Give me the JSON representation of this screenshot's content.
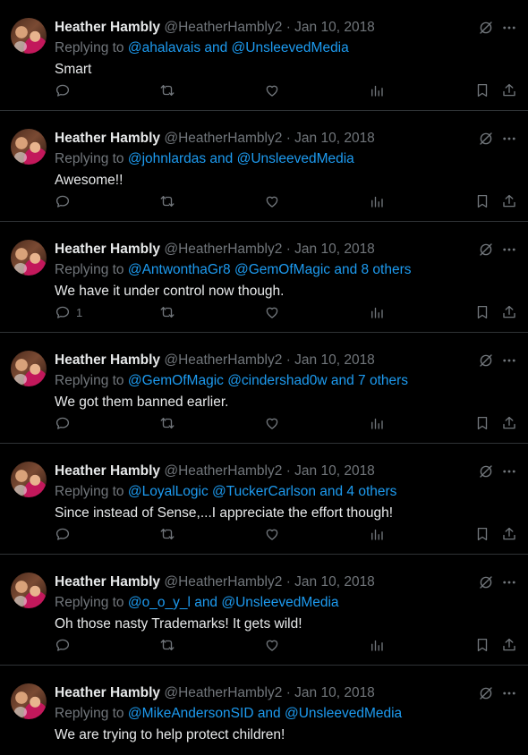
{
  "tweets": [
    {
      "name": "Heather Hambly",
      "handle": "@HeatherHambly2",
      "sep": "·",
      "date": "Jan 10, 2018",
      "reply_prefix": "Replying to ",
      "reply_to": "@ahalavais and @UnsleevedMedia",
      "text": "Smart",
      "reply_count": ""
    },
    {
      "name": "Heather Hambly",
      "handle": "@HeatherHambly2",
      "sep": "·",
      "date": "Jan 10, 2018",
      "reply_prefix": "Replying to ",
      "reply_to": "@johnlardas and @UnsleevedMedia",
      "text": "Awesome!!",
      "reply_count": ""
    },
    {
      "name": "Heather Hambly",
      "handle": "@HeatherHambly2",
      "sep": "·",
      "date": "Jan 10, 2018",
      "reply_prefix": "Replying to ",
      "reply_to": "@AntwonthaGr8 @GemOfMagic and 8 others",
      "text": "We have it under control now though.",
      "reply_count": "1"
    },
    {
      "name": "Heather Hambly",
      "handle": "@HeatherHambly2",
      "sep": "·",
      "date": "Jan 10, 2018",
      "reply_prefix": "Replying to ",
      "reply_to": "@GemOfMagic @cindershad0w and 7 others",
      "text": "We got them banned earlier.",
      "reply_count": ""
    },
    {
      "name": "Heather Hambly",
      "handle": "@HeatherHambly2",
      "sep": "·",
      "date": "Jan 10, 2018",
      "reply_prefix": "Replying to ",
      "reply_to": "@LoyalLogic @TuckerCarlson and 4 others",
      "text": "Since instead of Sense,...I appreciate the effort though!",
      "reply_count": ""
    },
    {
      "name": "Heather Hambly",
      "handle": "@HeatherHambly2",
      "sep": "·",
      "date": "Jan 10, 2018",
      "reply_prefix": "Replying to ",
      "reply_to": "@o_o_y_l and @UnsleevedMedia",
      "text": "Oh those nasty Trademarks! It gets wild!",
      "reply_count": ""
    },
    {
      "name": "Heather Hambly",
      "handle": "@HeatherHambly2",
      "sep": "·",
      "date": "Jan 10, 2018",
      "reply_prefix": "Replying to ",
      "reply_to": "@MikeAndersonSID and @UnsleevedMedia",
      "text": "We are trying to help protect children!",
      "reply_count": ""
    }
  ],
  "icons": {
    "reply": "reply-icon",
    "retweet": "retweet-icon",
    "like": "like-icon",
    "views": "views-icon",
    "bookmark": "bookmark-icon",
    "share": "share-icon",
    "grok": "grok-icon",
    "more": "more-icon"
  },
  "colors": {
    "background": "#000000",
    "text": "#e7e9ea",
    "muted": "#71767b",
    "link": "#1d9bf0",
    "divider": "#2f3336"
  }
}
